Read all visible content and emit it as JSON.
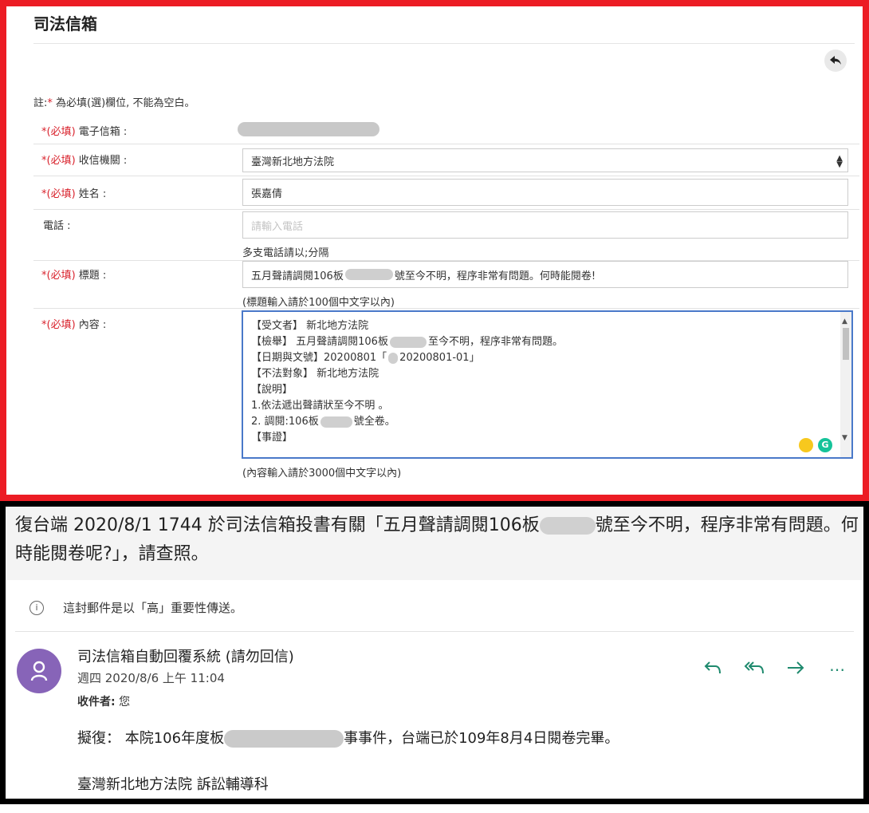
{
  "form": {
    "title": "司法信箱",
    "note_prefix": "註:",
    "note_star": "*",
    "note_text": "為必填(選)欄位, 不能為空白。",
    "required_tag": "*(必填)",
    "fields": {
      "email_label": "電子信箱 :",
      "agency_label": "收信機關 :",
      "agency_value": "臺灣新北地方法院",
      "name_label": "姓名 :",
      "name_value": "張嘉倩",
      "phone_label": "電話 :",
      "phone_placeholder": "請輸入電話",
      "phone_help": "多支電話請以;分隔",
      "subject_label": "標題 :",
      "subject_before": "五月聲請調閱106板",
      "subject_after": "號至今不明，程序非常有問題。何時能閱卷!",
      "subject_help": "(標題輸入請於100個中文字以內)",
      "content_label": "內容 :",
      "content_help": "(內容輸入請於3000個中文字以內)"
    },
    "content_lines": [
      "【受文者】 新北地方法院",
      "【檢舉】 五月聲請調閱106板",
      "至今不明，程序非常有問題。",
      "【日期與文號】20200801「",
      "20200801-01」",
      "【不法對象】 新北地方法院",
      "【說明】",
      "1.依法遞出聲請狀至今不明 。",
      "2. 調閱:106板",
      "號全卷。",
      "【事證】"
    ]
  },
  "mail": {
    "subject_before": "復台端 2020/8/1 1744 於司法信箱投書有關「五月聲請調閱106板",
    "subject_after": "號至今不明，程序非常有問題。何時能閱卷呢?」，請查照。",
    "importance": "這封郵件是以「高」重要性傳送。",
    "sender": "司法信箱自動回覆系統 (請勿回信)",
    "date": "週四 2020/8/6 上午 11:04",
    "recipient_label": "收件者:",
    "recipient_value": "您",
    "body_before": "擬復： 本院106年度板",
    "body_after": "事事件，台端已於109年8月4日閱卷完畢。",
    "signature": "臺灣新北地方法院 訴訟輔導科"
  },
  "icons": {
    "back": "back-arrow-icon",
    "info": "info-icon",
    "reply": "reply-icon",
    "reply_all": "reply-all-icon",
    "forward": "forward-icon",
    "more": "more-icon"
  },
  "colors": {
    "form_frame": "#ec1c24",
    "mail_frame": "#000000",
    "required": "#d9232d",
    "focus_border": "#4a79c9",
    "avatar": "#8764b8",
    "action": "#1f8a6e"
  }
}
